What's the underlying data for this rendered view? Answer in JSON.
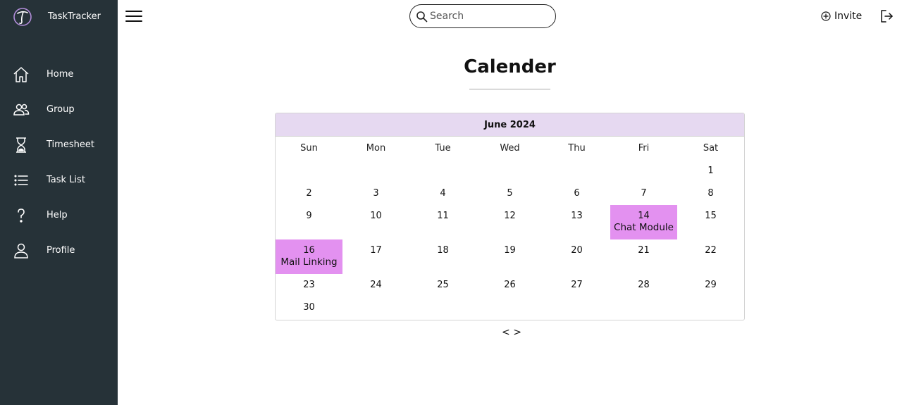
{
  "app": {
    "name": "TaskTracker"
  },
  "sidebar": {
    "items": [
      {
        "label": "Home",
        "icon": "home-icon"
      },
      {
        "label": "Group",
        "icon": "group-icon"
      },
      {
        "label": "Timesheet",
        "icon": "hourglass-icon"
      },
      {
        "label": "Task List",
        "icon": "list-icon"
      },
      {
        "label": "Help",
        "icon": "help-icon"
      },
      {
        "label": "Profile",
        "icon": "user-icon"
      }
    ]
  },
  "header": {
    "search_placeholder": "Search",
    "invite_label": "Invite"
  },
  "page": {
    "title": "Calender"
  },
  "calendar": {
    "month_label": "June 2024",
    "weekdays": [
      "Sun",
      "Mon",
      "Tue",
      "Wed",
      "Thu",
      "Fri",
      "Sat"
    ],
    "weeks": [
      [
        null,
        null,
        null,
        null,
        null,
        null,
        "1"
      ],
      [
        "2",
        "3",
        "4",
        "5",
        "6",
        "7",
        "8"
      ],
      [
        "9",
        "10",
        "11",
        "12",
        "13",
        "14",
        "15"
      ],
      [
        "16",
        "17",
        "18",
        "19",
        "20",
        "21",
        "22"
      ],
      [
        "23",
        "24",
        "25",
        "26",
        "27",
        "28",
        "29"
      ],
      [
        "30",
        null,
        null,
        null,
        null,
        null,
        null
      ]
    ],
    "events": [
      {
        "day": "14",
        "label": "Chat Module"
      },
      {
        "day": "16",
        "label": "Mail Linking"
      }
    ],
    "event_color": "#e391f0",
    "header_color": "#e6d9f1",
    "nav_prev": "<",
    "nav_next": ">"
  },
  "colors": {
    "sidebar_bg": "#263238"
  }
}
